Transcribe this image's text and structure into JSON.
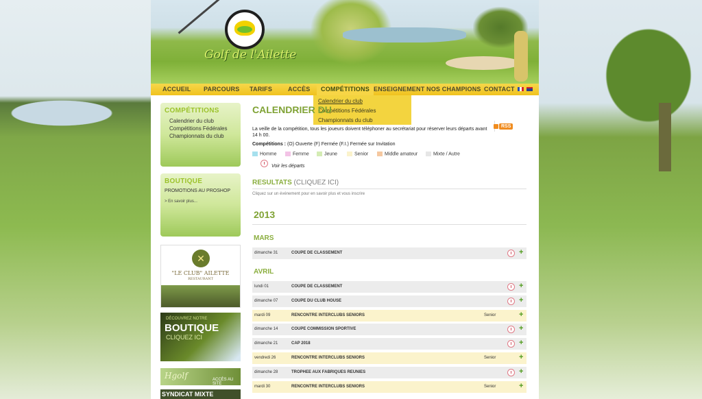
{
  "header": {
    "logo_text": "Golf de l'Ailette"
  },
  "nav": {
    "items": [
      "ACCUEIL",
      "PARCOURS",
      "TARIFS",
      "ACCÈS",
      "COMPÉTITIONS",
      "ENSEIGNEMENT",
      "NOS CHAMPIONS",
      "CONTACT"
    ],
    "flags": [
      "fr-flag-icon",
      "uk-flag-icon"
    ]
  },
  "dropdown": {
    "items": [
      "Calendrier du club",
      "Compétitions Fédérales",
      "Championnats du club"
    ]
  },
  "sidebar": {
    "competitions": {
      "title": "COMPÉTITIONS",
      "links": [
        "Calendrier du club",
        "Compétitions Fédérales",
        "Championnats du club"
      ]
    },
    "boutique": {
      "title": "BOUTIQUE",
      "promo": "PROMOTIONS AU PROSHOP",
      "more": "> En savoir plus..."
    },
    "club_banner": {
      "logo_glyph": "✕",
      "name": "\"LE CLUB\" AILETTE",
      "sub": "RESTAURANT"
    },
    "boutique_banner": {
      "line1": "DÉCOUVREZ NOTRE",
      "line2": "BOUTIQUE",
      "line3": "CLIQUEZ ICI"
    },
    "hgolf_banner": {
      "brand": "Hgolf",
      "cta": "ACCÈS AU SITE"
    },
    "syndicat_banner": {
      "text": "SYNDICAT MIXTE"
    }
  },
  "main": {
    "title": "CALENDRIER DU",
    "rss_label": "RSS",
    "intro": "La veille de la compétition, tous les joueurs doivent téléphoner au secrétariat pour réserver leurs départs avant 14 h 00.",
    "competitions_label": "Compétitions :",
    "competitions_legend": " (O) Ouverte (F) Fermée  (F.I.) Fermée sur Invitation",
    "legend": [
      {
        "label": "Homme",
        "color": "#a6e0ee"
      },
      {
        "label": "Femme",
        "color": "#f3c3e6"
      },
      {
        "label": "Jeune",
        "color": "#d4ecb4"
      },
      {
        "label": "Senior",
        "color": "#fbf3cc"
      },
      {
        "label": "Middle amateur",
        "color": "#f5c8a0"
      },
      {
        "label": "Mixte / Autre",
        "color": "#e6e6e6"
      }
    ],
    "voir_departs": "Voir les départs",
    "results_title": "RESULTATS",
    "results_link": " (CLIQUEZ ICI)",
    "results_note": "Cliquez sur un événement pour en savoir plus et vous inscrire",
    "year": "2013",
    "months": [
      {
        "name": "MARS",
        "events": [
          {
            "date": "dimanche 31",
            "name": "COUPE DE CLASSEMENT",
            "category": "",
            "departs": true,
            "senior": false
          }
        ]
      },
      {
        "name": "AVRIL",
        "events": [
          {
            "date": "lundi 01",
            "name": "COUPE DE CLASSEMENT",
            "category": "",
            "departs": true,
            "senior": false
          },
          {
            "date": "dimanche 07",
            "name": "COUPE DU CLUB HOUSE",
            "category": "",
            "departs": true,
            "senior": false
          },
          {
            "date": "mardi 09",
            "name": "RENCONTRE INTERCLUBS SENIORS",
            "category": "Senior",
            "departs": false,
            "senior": true
          },
          {
            "date": "dimanche 14",
            "name": "COUPE COMMISSION SPORTIVE",
            "category": "",
            "departs": true,
            "senior": false
          },
          {
            "date": "dimanche 21",
            "name": "CAP 2018",
            "category": "",
            "departs": true,
            "senior": false
          },
          {
            "date": "vendredi 26",
            "name": "RENCONTRE INTERCLUBS SENIORS",
            "category": "Senior",
            "departs": false,
            "senior": true
          },
          {
            "date": "dimanche 28",
            "name": "TROPHEE AUX FABRIQUES REUNIES",
            "category": "",
            "departs": true,
            "senior": false
          },
          {
            "date": "mardi 30",
            "name": "RENCONTRE INTERCLUBS SENIORS",
            "category": "Senior",
            "departs": false,
            "senior": true
          }
        ]
      }
    ],
    "plus_glyph": "+"
  }
}
